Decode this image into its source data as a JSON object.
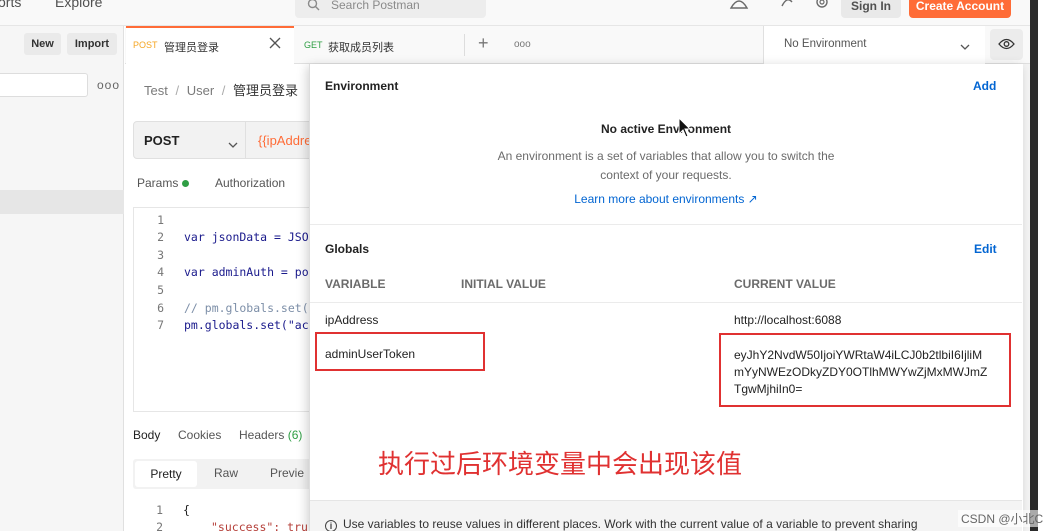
{
  "topbar": {
    "nav_left": "orts",
    "nav_explore": "Explore",
    "search_placeholder": "Search Postman",
    "signin": "Sign In",
    "create_account": "Create Account"
  },
  "sidebar": {
    "new_label": "New",
    "import_label": "Import",
    "more": "ooo"
  },
  "tabs": [
    {
      "method": "POST",
      "title": "管理员登录",
      "active": true,
      "method_color": "#f5a623"
    },
    {
      "method": "GET",
      "title": "获取成员列表",
      "active": false,
      "method_color": "#2f9e44"
    }
  ],
  "tabs_extra": {
    "add": "+",
    "more": "ooo"
  },
  "environment_selector": {
    "value": "No Environment"
  },
  "request": {
    "breadcrumb": [
      "Test",
      "/",
      "User",
      "/",
      "管理员登录"
    ],
    "method": "POST",
    "url": "{{ipAddre",
    "tabs": [
      "Params",
      "Authorization"
    ],
    "code": [
      {
        "no": "1",
        "text": ""
      },
      {
        "no": "2",
        "text": "var jsonData = JSO"
      },
      {
        "no": "3",
        "text": ""
      },
      {
        "no": "4",
        "text": "var adminAuth = po"
      },
      {
        "no": "5",
        "text": ""
      },
      {
        "no": "6",
        "text": "// pm.globals.set("
      },
      {
        "no": "7",
        "text": "pm.globals.set(\"ac"
      }
    ]
  },
  "response": {
    "tabs": [
      "Body",
      "Cookies",
      "Headers"
    ],
    "headers_count": "(6)",
    "view_tabs": [
      "Pretty",
      "Raw",
      "Previe"
    ],
    "lines": [
      {
        "no": "1",
        "text": "{"
      },
      {
        "no": "2",
        "text": "\"success\": tru"
      }
    ]
  },
  "panel": {
    "environment_heading": "Environment",
    "add_label": "Add",
    "no_active_title": "No active Environment",
    "description_line1": "An environment is a set of variables that allow you to switch the",
    "description_line2": "context of your requests.",
    "learn_more": "Learn more about environments ↗",
    "globals_heading": "Globals",
    "edit_label": "Edit",
    "columns": [
      "VARIABLE",
      "INITIAL VALUE",
      "CURRENT VALUE"
    ],
    "rows": [
      {
        "variable": "ipAddress",
        "initial": "",
        "current": [
          "http://localhost:6088"
        ]
      },
      {
        "variable": "adminUserToken",
        "initial": "",
        "current": [
          "eyJhY2NvdW50IjoiYWRtaW4iLCJ0b2tlbiI6IjliM",
          "mYyNWEzODkyZDY0OTlhMWYwZjMxMWJmZ",
          "TgwMjhiIn0="
        ]
      }
    ],
    "annotation": "执行过后环境变量中会出现该值",
    "footer": "Use variables to reuse values in different places. Work with the current value of a variable to prevent sharing"
  },
  "watermark": "CSDN @小北C",
  "colors": {
    "accent": "#ff6c37",
    "link": "#0265d2",
    "annotation_red": "#e03131",
    "status_green": "#2f9e44"
  }
}
